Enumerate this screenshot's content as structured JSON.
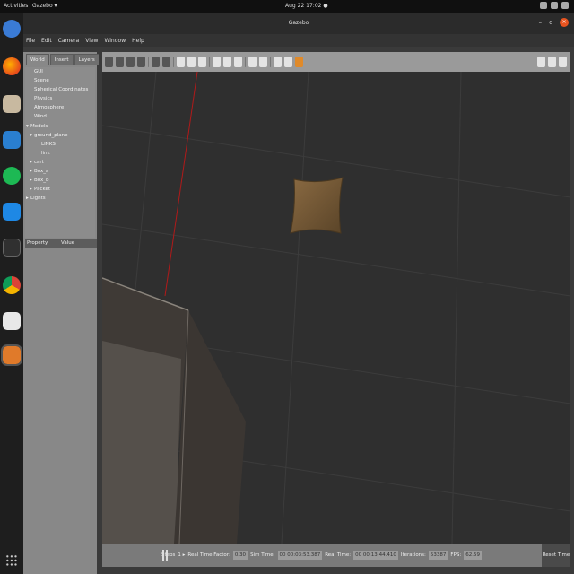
{
  "topbar": {
    "activities": "Activities",
    "app_menu": "Gazebo ▾",
    "clock": "Aug 22  17:02  ●"
  },
  "dock": {
    "items": [
      "help-icon",
      "firefox-icon",
      "files-icon",
      "writer-icon",
      "spotify-icon",
      "vscode-icon",
      "terminal-icon",
      "chrome-icon",
      "libreoffice-icon",
      "gazebo-icon"
    ],
    "apps_icon": "show-apps-icon"
  },
  "window": {
    "title": "Gazebo",
    "min_glyph": "–",
    "restore_glyph": "c",
    "close_glyph": "×"
  },
  "menubar": {
    "items": [
      "File",
      "Edit",
      "Camera",
      "View",
      "Window",
      "Help"
    ]
  },
  "panel": {
    "tabs": [
      "World",
      "Insert",
      "Layers"
    ],
    "tree": [
      {
        "label": "GUI",
        "indent": 1,
        "arrow": ""
      },
      {
        "label": "Scene",
        "indent": 1,
        "arrow": ""
      },
      {
        "label": "Spherical Coordinates",
        "indent": 1,
        "arrow": ""
      },
      {
        "label": "Physics",
        "indent": 1,
        "arrow": ""
      },
      {
        "label": "Atmosphere",
        "indent": 1,
        "arrow": ""
      },
      {
        "label": "Wind",
        "indent": 1,
        "arrow": ""
      },
      {
        "label": "Models",
        "indent": 0,
        "arrow": "▾"
      },
      {
        "label": "ground_plane",
        "indent": 1,
        "arrow": "▾"
      },
      {
        "label": "LINKS",
        "indent": 3,
        "arrow": ""
      },
      {
        "label": "link",
        "indent": 3,
        "arrow": ""
      },
      {
        "label": "cart",
        "indent": 1,
        "arrow": "▸"
      },
      {
        "label": "Box_a",
        "indent": 1,
        "arrow": "▸"
      },
      {
        "label": "Box_b",
        "indent": 1,
        "arrow": "▸"
      },
      {
        "label": "Packet",
        "indent": 1,
        "arrow": "▸"
      },
      {
        "label": "Lights",
        "indent": 0,
        "arrow": "▸"
      }
    ],
    "props_header": {
      "property": "Property",
      "value": "Value"
    }
  },
  "bottombar": {
    "steps_label": "Steps",
    "steps_value": "1 ▸",
    "rtf_label": "Real Time Factor:",
    "rtf_value": "0.30",
    "sim_time_label": "Sim Time:",
    "sim_time_value": "00 00:03:53.387",
    "real_time_label": "Real Time:",
    "real_time_value": "00 00:13:44.410",
    "iterations_label": "Iterations:",
    "iterations_value": "53387",
    "fps_label": "FPS:",
    "fps_value": "62.59",
    "reset_label": "Reset Time"
  },
  "colors": {
    "accent": "#e95420",
    "box": "#6e5538",
    "axis_red": "#b01a1a",
    "axis_blue": "#2030c0"
  }
}
